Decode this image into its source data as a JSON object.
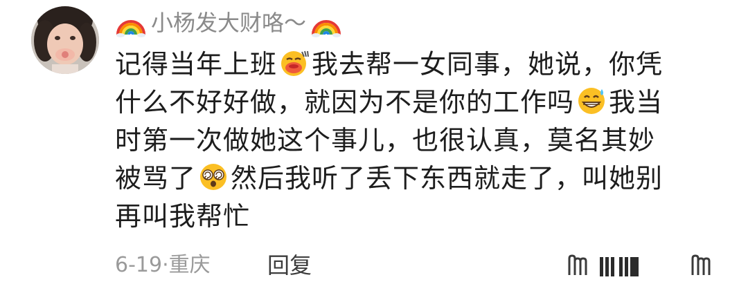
{
  "comment": {
    "username": "小杨发大财咯～",
    "username_decorations": [
      "rainbow-icon",
      "rainbow-icon"
    ],
    "lines": [
      {
        "segments": [
          "记得当年上班",
          "我去帮一女同事，她说，你凭"
        ],
        "emoji": "pouting-face-icon"
      },
      {
        "segments": [
          "什么不好好做，就因为不是你的工作吗",
          "我当"
        ],
        "emoji": "grinning-sweat-icon"
      },
      {
        "segments": [
          "时第一次做她这个事儿，也很认真，莫名其妙",
          ""
        ],
        "emoji": null
      },
      {
        "segments": [
          "被骂了",
          "然后我听了丢下东西就走了，叫她别"
        ],
        "emoji": "dizzy-face-icon"
      },
      {
        "segments": [
          "再叫我帮忙",
          ""
        ],
        "emoji": null
      }
    ],
    "date": "6-19",
    "separator": "·",
    "location": "重庆",
    "reply_label": "回复"
  },
  "colors": {
    "username": "#8a8a8a",
    "body_text": "#1d1d1d",
    "meta_text": "#9a9a9a",
    "reply_text": "#3c3c3c"
  }
}
